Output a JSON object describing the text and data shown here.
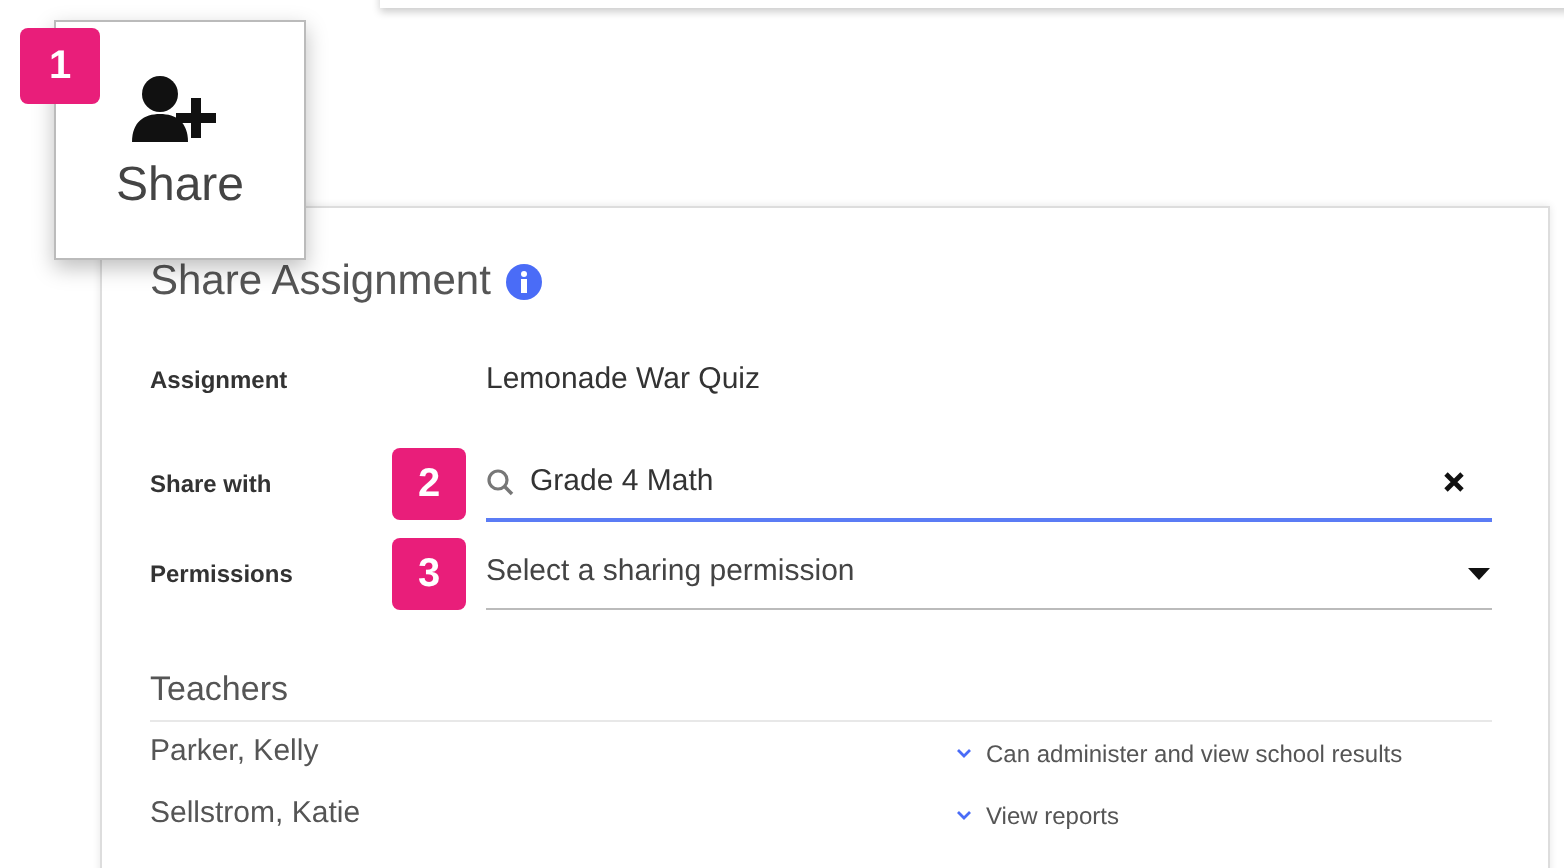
{
  "share_button": {
    "label": "Share",
    "badge": "1"
  },
  "dialog": {
    "title": "Share Assignment",
    "assignment": {
      "label": "Assignment",
      "value": "Lemonade War Quiz"
    },
    "share_with": {
      "label": "Share with",
      "badge": "2",
      "value": "Grade 4 Math",
      "focused": true
    },
    "permissions": {
      "label": "Permissions",
      "badge": "3",
      "placeholder": "Select a sharing permission"
    },
    "teachers": {
      "heading": "Teachers",
      "rows": [
        {
          "name": "Parker, Kelly",
          "permission": "Can administer and view school results"
        },
        {
          "name": "Sellstrom, Katie",
          "permission": "View reports"
        }
      ]
    }
  }
}
